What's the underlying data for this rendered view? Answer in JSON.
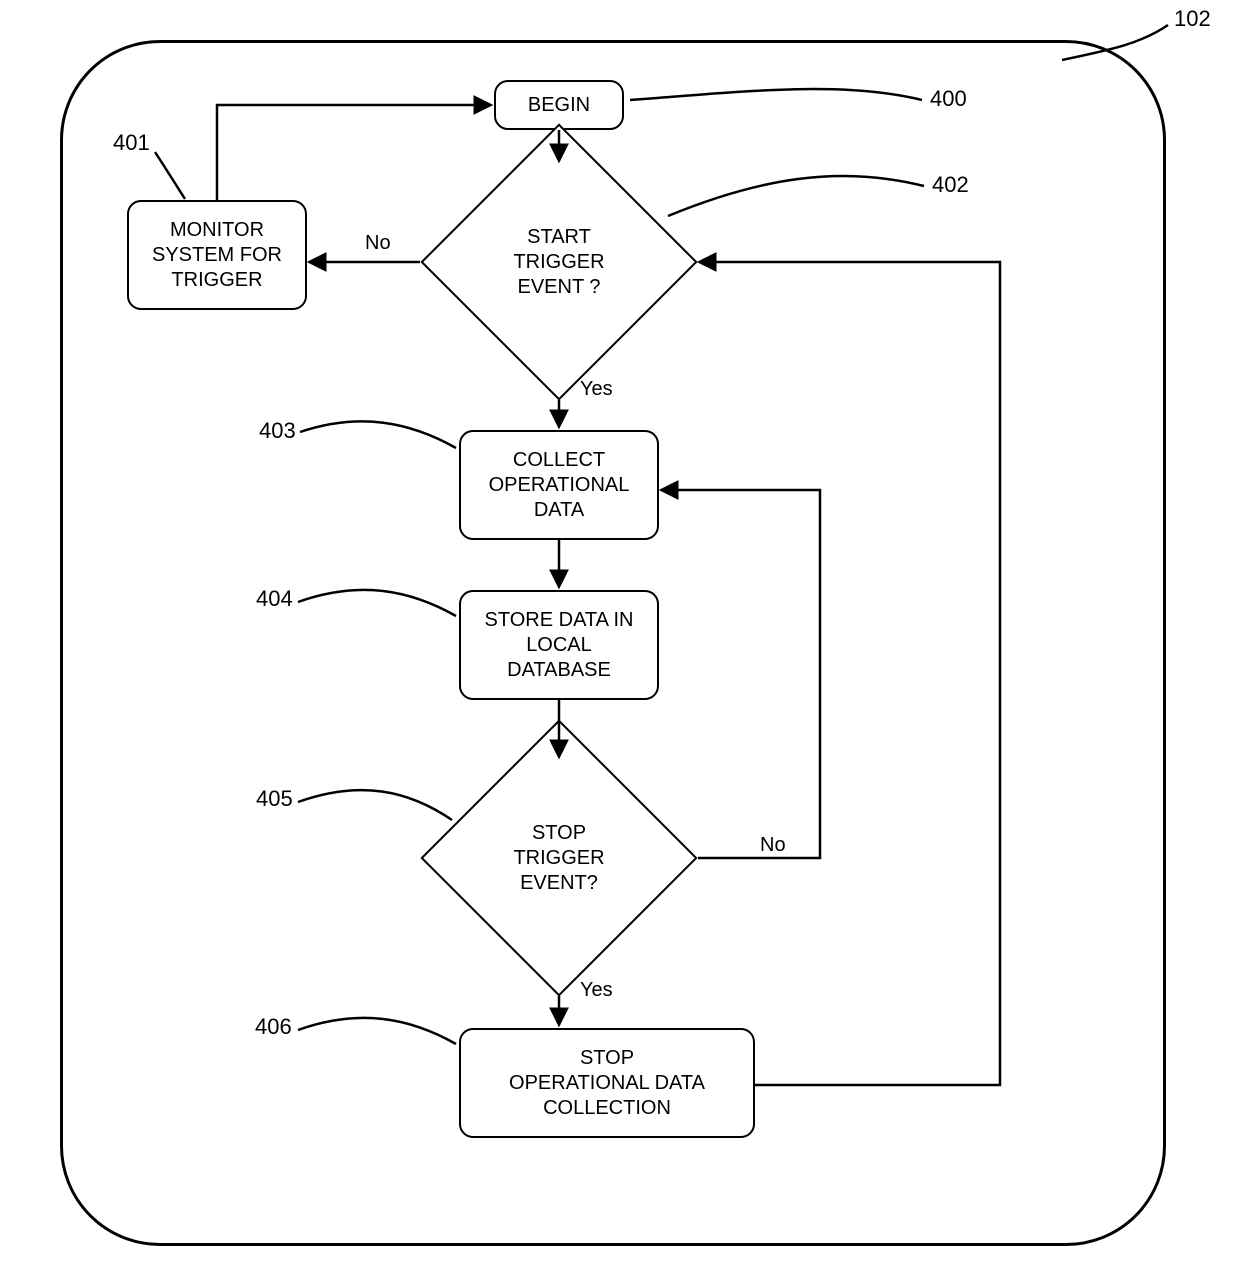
{
  "frame_label": "102",
  "nodes": {
    "begin": {
      "label": "BEGIN",
      "ref": "400"
    },
    "monitor": {
      "label": "MONITOR\nSYSTEM FOR\nTRIGGER",
      "ref": "401"
    },
    "start_trigger": {
      "label": "START\nTRIGGER\nEVENT ?",
      "ref": "402"
    },
    "collect": {
      "label": "COLLECT\nOPERATIONAL\nDATA",
      "ref": "403"
    },
    "store": {
      "label": "STORE DATA IN\nLOCAL\nDATABASE",
      "ref": "404"
    },
    "stop_trigger": {
      "label": "STOP\nTRIGGER\nEVENT?",
      "ref": "405"
    },
    "stop_collect": {
      "label": "STOP\nOPERATIONAL DATA\nCOLLECTION",
      "ref": "406"
    }
  },
  "edges": {
    "no1": "No",
    "yes1": "Yes",
    "no2": "No",
    "yes2": "Yes"
  }
}
